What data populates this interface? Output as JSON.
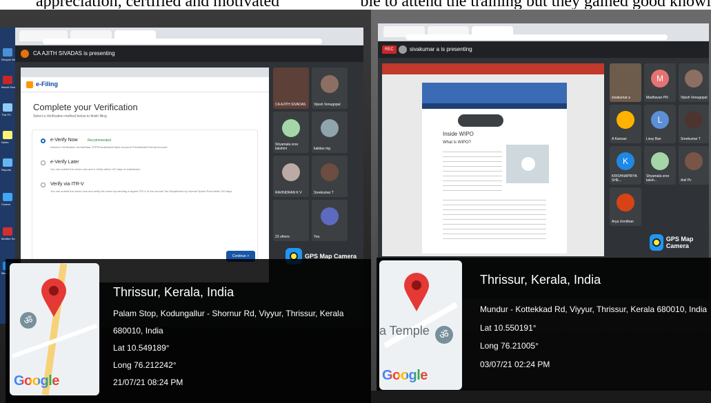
{
  "caption_left": "appreciation, certified and motivated",
  "caption_right": "ble to attend the training but they gained good knowl",
  "photo1": {
    "presenting": "CA AJITH SIVADAS is presenting",
    "page_heading": "Complete your Verification",
    "page_sub": "Select a Verification method below to finish filing",
    "efiling_logo": "e-Filing",
    "options": [
      {
        "label": "e-Verify Now",
        "tag": "Recommended",
        "desc": "Instant e-Verification via Aadhaar OTP/Prevalidated Bank Account/ Prevalidated Demat Account"
      },
      {
        "label": "e-Verify Later",
        "desc": "You can submit the return now and e-Verify within 120 days of submission"
      },
      {
        "label": "Verify via ITR-V",
        "desc": "You can submit the return now and verify the return by sending a signed ITR-V to the Income Tax Department by Normal Speed Post within 120 days"
      }
    ],
    "continue_label": "Continue >",
    "participants": [
      "CA AJITH SIVADAS",
      "Vijesh Venugopal",
      "Shyamala sree lakshmi",
      "kalidas mg",
      "RAVINDRAN K V",
      "Sreekumar T",
      "23 others",
      "You"
    ],
    "desktop_labels": [
      "Recycle Bin",
      "Maruti Dealer",
      "This PC",
      "Notes",
      "Reports",
      "Control",
      "McAfee Security",
      "Microsoft Edge"
    ],
    "gps_app": "GPS Map Camera",
    "city": "Thrissur, Kerala, India",
    "address": "Palam Stop, Kodungallur - Shornur Rd, Viyyur, Thrissur, Kerala",
    "address2": "680010, India",
    "lat": "Lat 10.549189°",
    "long": "Long 76.212242°",
    "datetime": "21/07/21 08:24 PM",
    "google": "Google"
  },
  "photo2": {
    "presenting": "sivakumar a is presenting",
    "rec": "REC",
    "wipo_heading": "Inside WIPO",
    "wipo_sub": "What is WIPO?",
    "participants": [
      "sivakumar a",
      "Madhavan PN",
      "Vijesh Venugopal",
      "A Kannan",
      "Lissy Ban",
      "Sreekumar T",
      "KRISHNAPRIYA SHE...",
      "Shyamala sree laksh...",
      "Anil Pv",
      "Arya Unnithan"
    ],
    "avatar_letters": [
      "M",
      "L",
      "K"
    ],
    "gps_app": "GPS Map Camera",
    "city": "Thrissur, Kerala, India",
    "address": "Mundur - Kottekkad Rd, Viyyur, Thrissur, Kerala 680010, India",
    "lat": "Lat 10.550191°",
    "long": "Long 76.21005°",
    "datetime": "03/07/21 02:24 PM",
    "map_label": "a Temple",
    "google": "Google"
  },
  "colors": {
    "accent": "#4285f4",
    "pin": "#e53935",
    "gps_overlay": "#000000",
    "meet_dark": "#202124"
  }
}
